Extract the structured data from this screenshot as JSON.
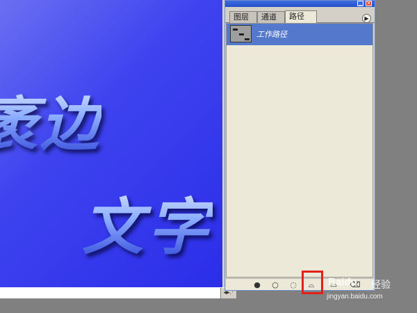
{
  "canvas": {
    "art_text_line_1": "袤边",
    "art_text_line_2": "文字"
  },
  "panel": {
    "tabs": [
      "图层",
      "通道",
      "路径"
    ],
    "active_tab": "路径",
    "menu_icon": "triangle-right-icon",
    "paths": [
      {
        "name": "工作路径",
        "selected": true
      }
    ],
    "footer_buttons": [
      {
        "name": "fill-path",
        "icon": "filled-circle-icon"
      },
      {
        "name": "stroke-path",
        "icon": "circle-outline-icon"
      },
      {
        "name": "load-selection",
        "icon": "dashed-circle-icon"
      },
      {
        "name": "make-work-path",
        "icon": "work-path-icon"
      },
      {
        "name": "new-path",
        "icon": "new-page-icon"
      },
      {
        "name": "delete-path",
        "icon": "trash-icon"
      }
    ]
  },
  "highlight": {
    "color": "#e0201a",
    "target": "make-work-path"
  },
  "watermark": {
    "logo": "Baidu",
    "cn": "经验",
    "url": "jingyan.baidu.com"
  },
  "colors": {
    "canvas_blue": "#3e43ef",
    "selection_blue": "#5378cc",
    "panel_bg": "#ece9d8"
  }
}
